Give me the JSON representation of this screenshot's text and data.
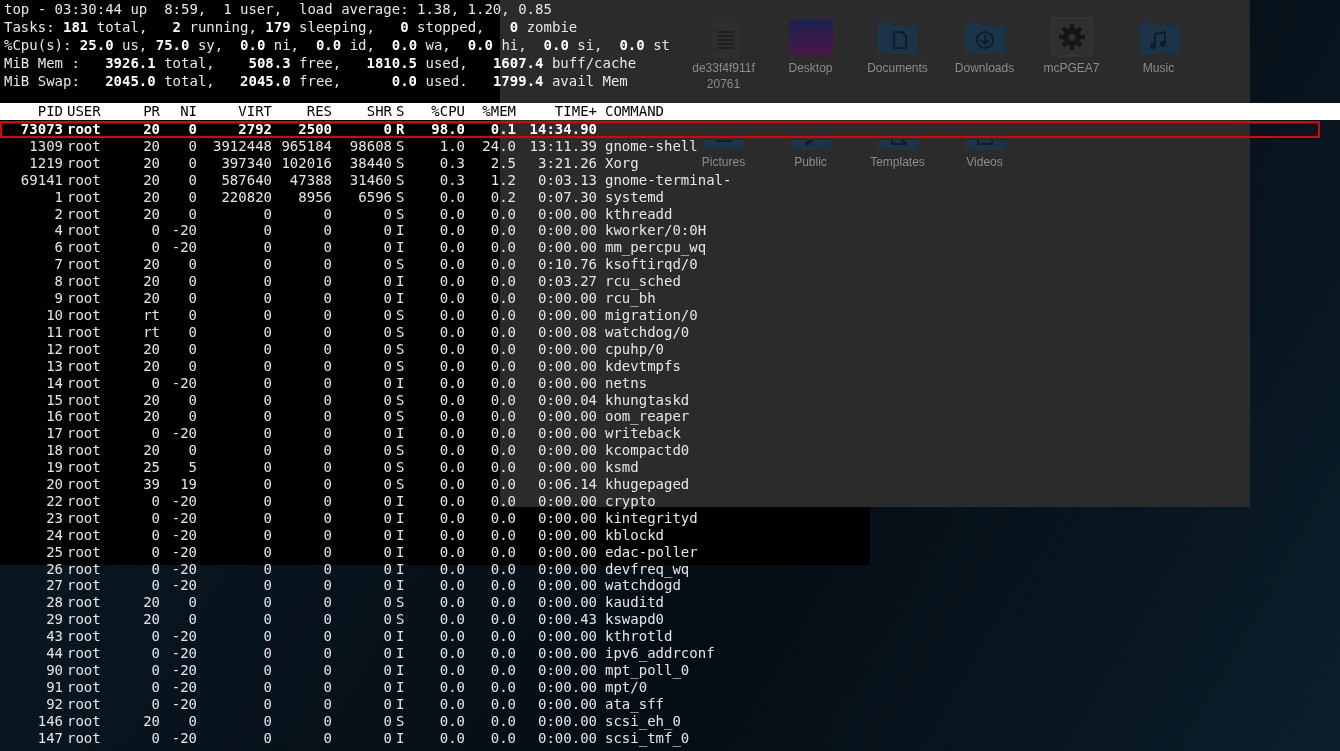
{
  "summary": [
    "top - 03:30:44 up  8:59,  1 user,  load average: 1.38, 1.20, 0.85",
    "Tasks: **181** total,   **2** running, **179** sleeping,   **0** stopped,   **0** zombie",
    "%Cpu(s): **25.0** us, **75.0** sy,  **0.0** ni,  **0.0** id,  **0.0** wa,  **0.0** hi,  **0.0** si,  **0.0** st",
    "MiB Mem :   **3926.1** total,    **508.3** free,   **1810.5** used,   **1607.4** buff/cache",
    "MiB Swap:   **2045.0** total,   **2045.0** free,      **0.0** used.   **1799.4** avail Mem"
  ],
  "columns": [
    "PID",
    "USER",
    "PR",
    "NI",
    "VIRT",
    "RES",
    "SHR",
    "S",
    "%CPU",
    "%MEM",
    "TIME+",
    "COMMAND"
  ],
  "processes": [
    {
      "selected": true,
      "cells": [
        "73073",
        "root",
        "20",
        "0",
        "2792",
        "2500",
        "0",
        "R",
        "98.0",
        "0.1",
        "14:34.90"
      ]
    },
    {
      "selected": false,
      "cells": [
        "1309",
        "root",
        "20",
        "0",
        "3912448",
        "965184",
        "98608",
        "S",
        "1.0",
        "24.0",
        "13:11.39",
        "gnome-shell"
      ]
    },
    {
      "selected": false,
      "cells": [
        "1219",
        "root",
        "20",
        "0",
        "397340",
        "102016",
        "38440",
        "S",
        "0.3",
        "2.5",
        "3:21.26",
        "Xorg"
      ]
    },
    {
      "selected": false,
      "cells": [
        "69141",
        "root",
        "20",
        "0",
        "587640",
        "47388",
        "31460",
        "S",
        "0.3",
        "1.2",
        "0:03.13",
        "gnome-terminal-"
      ]
    },
    {
      "selected": false,
      "cells": [
        "1",
        "root",
        "20",
        "0",
        "220820",
        "8956",
        "6596",
        "S",
        "0.0",
        "0.2",
        "0:07.30",
        "systemd"
      ]
    },
    {
      "selected": false,
      "cells": [
        "2",
        "root",
        "20",
        "0",
        "0",
        "0",
        "0",
        "S",
        "0.0",
        "0.0",
        "0:00.00",
        "kthreadd"
      ]
    },
    {
      "selected": false,
      "cells": [
        "4",
        "root",
        "0",
        "-20",
        "0",
        "0",
        "0",
        "I",
        "0.0",
        "0.0",
        "0:00.00",
        "kworker/0:0H"
      ]
    },
    {
      "selected": false,
      "cells": [
        "6",
        "root",
        "0",
        "-20",
        "0",
        "0",
        "0",
        "I",
        "0.0",
        "0.0",
        "0:00.00",
        "mm_percpu_wq"
      ]
    },
    {
      "selected": false,
      "cells": [
        "7",
        "root",
        "20",
        "0",
        "0",
        "0",
        "0",
        "S",
        "0.0",
        "0.0",
        "0:10.76",
        "ksoftirqd/0"
      ]
    },
    {
      "selected": false,
      "cells": [
        "8",
        "root",
        "20",
        "0",
        "0",
        "0",
        "0",
        "I",
        "0.0",
        "0.0",
        "0:03.27",
        "rcu_sched"
      ]
    },
    {
      "selected": false,
      "cells": [
        "9",
        "root",
        "20",
        "0",
        "0",
        "0",
        "0",
        "I",
        "0.0",
        "0.0",
        "0:00.00",
        "rcu_bh"
      ]
    },
    {
      "selected": false,
      "cells": [
        "10",
        "root",
        "rt",
        "0",
        "0",
        "0",
        "0",
        "S",
        "0.0",
        "0.0",
        "0:00.00",
        "migration/0"
      ]
    },
    {
      "selected": false,
      "cells": [
        "11",
        "root",
        "rt",
        "0",
        "0",
        "0",
        "0",
        "S",
        "0.0",
        "0.0",
        "0:00.08",
        "watchdog/0"
      ]
    },
    {
      "selected": false,
      "cells": [
        "12",
        "root",
        "20",
        "0",
        "0",
        "0",
        "0",
        "S",
        "0.0",
        "0.0",
        "0:00.00",
        "cpuhp/0"
      ]
    },
    {
      "selected": false,
      "cells": [
        "13",
        "root",
        "20",
        "0",
        "0",
        "0",
        "0",
        "S",
        "0.0",
        "0.0",
        "0:00.00",
        "kdevtmpfs"
      ]
    },
    {
      "selected": false,
      "cells": [
        "14",
        "root",
        "0",
        "-20",
        "0",
        "0",
        "0",
        "I",
        "0.0",
        "0.0",
        "0:00.00",
        "netns"
      ]
    },
    {
      "selected": false,
      "cells": [
        "15",
        "root",
        "20",
        "0",
        "0",
        "0",
        "0",
        "S",
        "0.0",
        "0.0",
        "0:00.04",
        "khungtaskd"
      ]
    },
    {
      "selected": false,
      "cells": [
        "16",
        "root",
        "20",
        "0",
        "0",
        "0",
        "0",
        "S",
        "0.0",
        "0.0",
        "0:00.00",
        "oom_reaper"
      ]
    },
    {
      "selected": false,
      "cells": [
        "17",
        "root",
        "0",
        "-20",
        "0",
        "0",
        "0",
        "I",
        "0.0",
        "0.0",
        "0:00.00",
        "writeback"
      ]
    },
    {
      "selected": false,
      "cells": [
        "18",
        "root",
        "20",
        "0",
        "0",
        "0",
        "0",
        "S",
        "0.0",
        "0.0",
        "0:00.00",
        "kcompactd0"
      ]
    },
    {
      "selected": false,
      "cells": [
        "19",
        "root",
        "25",
        "5",
        "0",
        "0",
        "0",
        "S",
        "0.0",
        "0.0",
        "0:00.00",
        "ksmd"
      ]
    },
    {
      "selected": false,
      "cells": [
        "20",
        "root",
        "39",
        "19",
        "0",
        "0",
        "0",
        "S",
        "0.0",
        "0.0",
        "0:06.14",
        "khugepaged"
      ]
    },
    {
      "selected": false,
      "cells": [
        "22",
        "root",
        "0",
        "-20",
        "0",
        "0",
        "0",
        "I",
        "0.0",
        "0.0",
        "0:00.00",
        "crypto"
      ]
    },
    {
      "selected": false,
      "cells": [
        "23",
        "root",
        "0",
        "-20",
        "0",
        "0",
        "0",
        "I",
        "0.0",
        "0.0",
        "0:00.00",
        "kintegrityd"
      ]
    },
    {
      "selected": false,
      "cells": [
        "24",
        "root",
        "0",
        "-20",
        "0",
        "0",
        "0",
        "I",
        "0.0",
        "0.0",
        "0:00.00",
        "kblockd"
      ]
    },
    {
      "selected": false,
      "cells": [
        "25",
        "root",
        "0",
        "-20",
        "0",
        "0",
        "0",
        "I",
        "0.0",
        "0.0",
        "0:00.00",
        "edac-poller"
      ]
    },
    {
      "selected": false,
      "cells": [
        "26",
        "root",
        "0",
        "-20",
        "0",
        "0",
        "0",
        "I",
        "0.0",
        "0.0",
        "0:00.00",
        "devfreq_wq"
      ]
    },
    {
      "selected": false,
      "cells": [
        "27",
        "root",
        "0",
        "-20",
        "0",
        "0",
        "0",
        "I",
        "0.0",
        "0.0",
        "0:00.00",
        "watchdogd"
      ]
    },
    {
      "selected": false,
      "cells": [
        "28",
        "root",
        "20",
        "0",
        "0",
        "0",
        "0",
        "S",
        "0.0",
        "0.0",
        "0:00.00",
        "kauditd"
      ]
    },
    {
      "selected": false,
      "cells": [
        "29",
        "root",
        "20",
        "0",
        "0",
        "0",
        "0",
        "S",
        "0.0",
        "0.0",
        "0:00.43",
        "kswapd0"
      ]
    },
    {
      "selected": false,
      "cells": [
        "43",
        "root",
        "0",
        "-20",
        "0",
        "0",
        "0",
        "I",
        "0.0",
        "0.0",
        "0:00.00",
        "kthrotld"
      ]
    },
    {
      "selected": false,
      "cells": [
        "44",
        "root",
        "0",
        "-20",
        "0",
        "0",
        "0",
        "I",
        "0.0",
        "0.0",
        "0:00.00",
        "ipv6_addrconf"
      ]
    },
    {
      "selected": false,
      "cells": [
        "90",
        "root",
        "0",
        "-20",
        "0",
        "0",
        "0",
        "I",
        "0.0",
        "0.0",
        "0:00.00",
        "mpt_poll_0"
      ]
    },
    {
      "selected": false,
      "cells": [
        "91",
        "root",
        "0",
        "-20",
        "0",
        "0",
        "0",
        "I",
        "0.0",
        "0.0",
        "0:00.00",
        "mpt/0"
      ]
    },
    {
      "selected": false,
      "cells": [
        "92",
        "root",
        "0",
        "-20",
        "0",
        "0",
        "0",
        "I",
        "0.0",
        "0.0",
        "0:00.00",
        "ata_sff"
      ]
    },
    {
      "selected": false,
      "cells": [
        "146",
        "root",
        "20",
        "0",
        "0",
        "0",
        "0",
        "S",
        "0.0",
        "0.0",
        "0:00.00",
        "scsi_eh_0"
      ]
    },
    {
      "selected": false,
      "cells": [
        "147",
        "root",
        "0",
        "-20",
        "0",
        "0",
        "0",
        "I",
        "0.0",
        "0.0",
        "0:00.00",
        "scsi_tmf_0"
      ]
    }
  ],
  "file_manager": {
    "items": [
      {
        "label": "de33f4f911f 20761",
        "kind": "file"
      },
      {
        "label": "Desktop",
        "kind": "image"
      },
      {
        "label": "Documents",
        "kind": "documents"
      },
      {
        "label": "Downloads",
        "kind": "downloads"
      },
      {
        "label": "mcPGEA7",
        "kind": "settings"
      },
      {
        "label": "Music",
        "kind": "music"
      },
      {
        "label": "Pictures",
        "kind": "pictures"
      },
      {
        "label": "Public",
        "kind": "public"
      },
      {
        "label": "Templates",
        "kind": "templates"
      },
      {
        "label": "Videos",
        "kind": "videos"
      }
    ]
  }
}
